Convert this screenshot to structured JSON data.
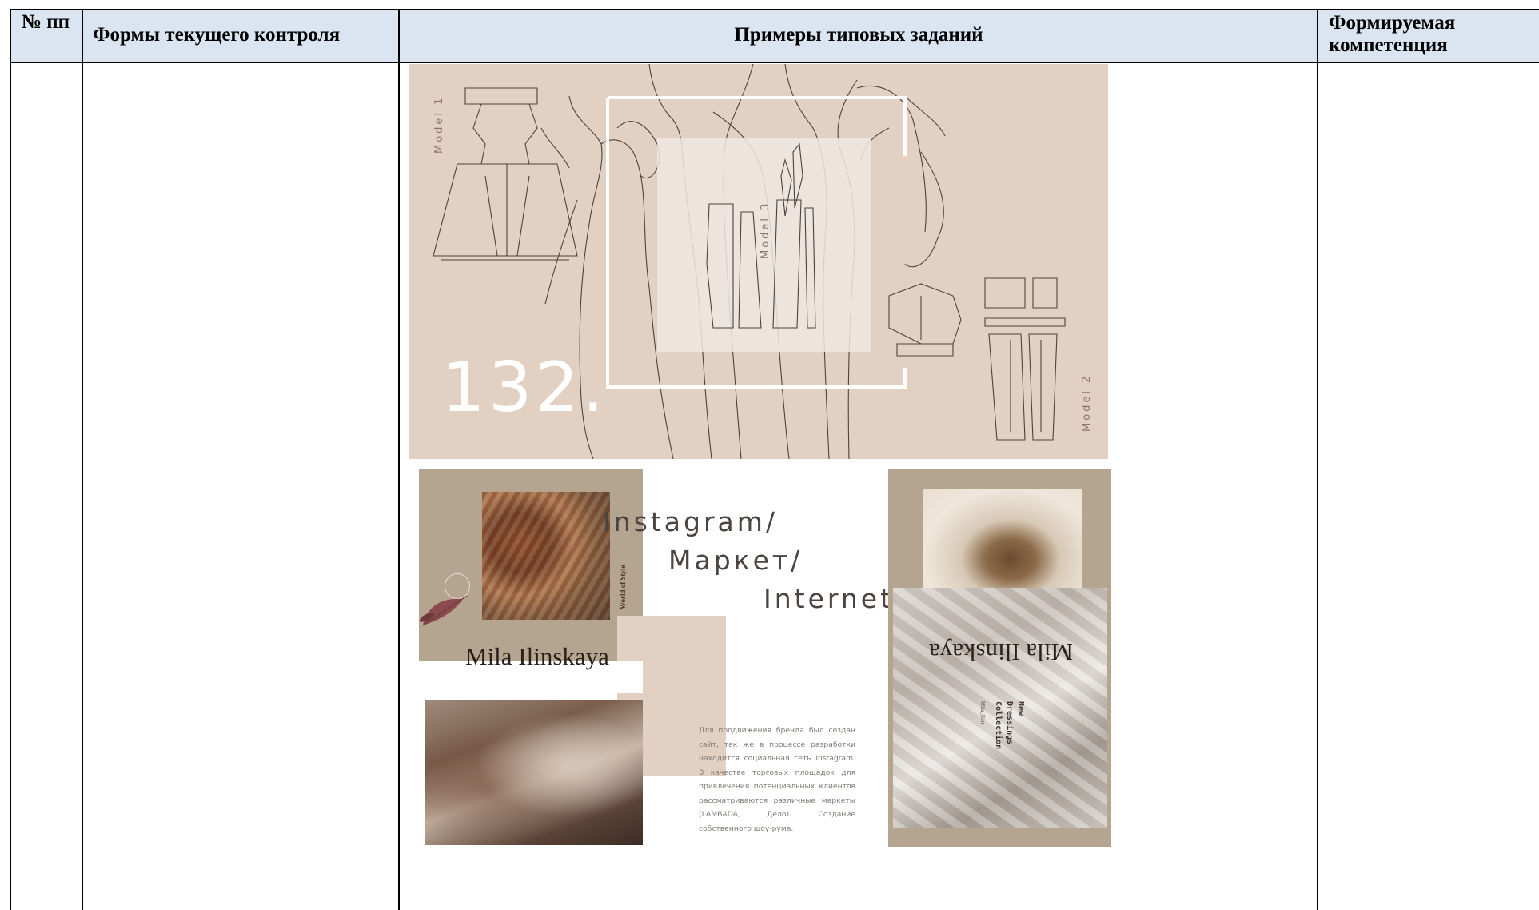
{
  "table": {
    "headers": {
      "num": "№ пп",
      "forms": "Формы текущего контроля",
      "examples": "Примеры типовых заданий",
      "competence": "Формируемая компетенция"
    }
  },
  "sketch_board": {
    "number": "132.",
    "model_labels": [
      "Model 1",
      "Model 3",
      "Model 2"
    ],
    "background_color": "#e2d1c3"
  },
  "collage": {
    "brand_left": "Mila Ilinskaya",
    "brand_right": "Mila Ilinskaya",
    "tag_vertical": "World of Style",
    "channels": [
      "Instagram/",
      "Маркет/",
      "Internet"
    ],
    "description": "Для продвижения бренда был создан сайт, так же в процессе разработки находится социальная сеть Instagram. В качестве торговых площадок для привлечения потенциальных клиентов рассматриваются различные маркеты (LAMBADA, Дело). Создание собственного шоу-рума.",
    "collection_title": "New\nDressings\nCollection",
    "collection_small": "Mila_Ilint",
    "accent_color": "#b5a48f"
  }
}
